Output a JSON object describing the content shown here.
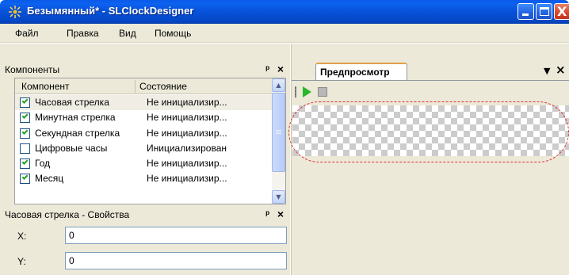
{
  "window": {
    "title": "Безымянный* - SLClockDesigner",
    "close_glyph": "X"
  },
  "menu": [
    "Файл",
    "Правка",
    "Вид",
    "Помощь"
  ],
  "components_panel": {
    "title": "Компоненты",
    "pin_glyph": "ᵖ",
    "close_glyph": "×",
    "columns": [
      "Компонент",
      "Состояние"
    ],
    "rows": [
      {
        "name": "Часовая стрелка",
        "state": "Не инициализир...",
        "checked": true
      },
      {
        "name": "Минутная стрелка",
        "state": "Не инициализир...",
        "checked": true
      },
      {
        "name": "Секундная стрелка",
        "state": "Не инициализир...",
        "checked": true
      },
      {
        "name": "Цифровые часы",
        "state": "Инициализирован",
        "checked": false
      },
      {
        "name": "Год",
        "state": "Не инициализир...",
        "checked": true
      },
      {
        "name": "Месяц",
        "state": "Не инициализир...",
        "checked": true
      }
    ]
  },
  "properties_panel": {
    "title": "Часовая стрелка - Свойства",
    "pin_glyph": "ᵖ",
    "close_glyph": "×",
    "fields": [
      {
        "label": "X:",
        "value": "0"
      },
      {
        "label": "Y:",
        "value": "0"
      }
    ]
  },
  "preview_panel": {
    "tab_label": "Предпросмотр",
    "dropdown_glyph": "▼",
    "close_glyph": "×"
  },
  "colors": {
    "titlebar": "#0751d8",
    "highlight_dashed": "#e03030",
    "play_green": "#2bb52b"
  },
  "icons": [
    "app-icon",
    "minimize-icon",
    "maximize-icon",
    "close-icon",
    "pin-icon",
    "play-icon",
    "stop-icon",
    "scroll-up-icon",
    "scroll-down-icon"
  ]
}
